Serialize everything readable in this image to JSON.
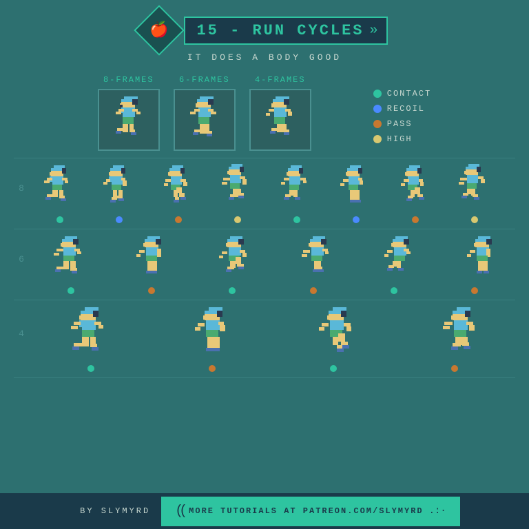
{
  "header": {
    "icon_symbol": "🍎",
    "title": "15 - RUN CYCLES",
    "subtitle": "IT DOES A BODY GOOD"
  },
  "previews": [
    {
      "label": "8-FRAMES"
    },
    {
      "label": "6-FRAMES"
    },
    {
      "label": "4-FRAMES"
    }
  ],
  "legend": [
    {
      "label": "CONTACT",
      "color_class": "dot-contact"
    },
    {
      "label": "RECOIL",
      "color_class": "dot-recoil"
    },
    {
      "label": "PASS",
      "color_class": "dot-pass"
    },
    {
      "label": "HIGH",
      "color_class": "dot-high"
    }
  ],
  "rows": [
    {
      "label": "8",
      "frames": 8,
      "dots": [
        "contact",
        "recoil",
        "pass",
        "high",
        "contact",
        "recoil",
        "pass",
        "high"
      ]
    },
    {
      "label": "6",
      "frames": 6,
      "dots": [
        "contact",
        "pass",
        "contact",
        "pass",
        "contact",
        "pass"
      ]
    },
    {
      "label": "4",
      "frames": 4,
      "dots": [
        "contact",
        "pass",
        "contact",
        "pass"
      ]
    }
  ],
  "footer": {
    "left_text": "BY SLYMYRD",
    "link_text": "MORE TUTORIALS AT PATREON.COM/SLYMYRD"
  }
}
